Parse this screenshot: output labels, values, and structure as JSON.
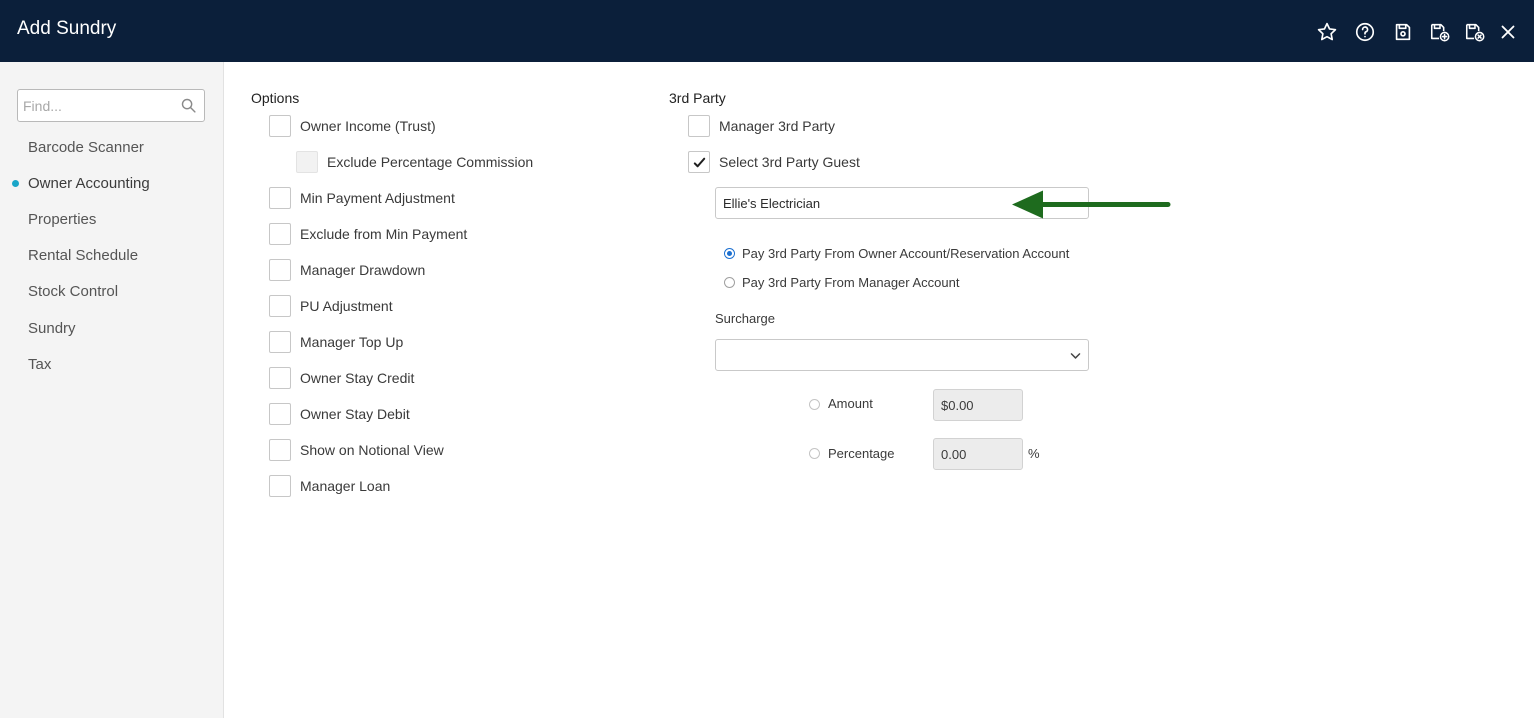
{
  "window": {
    "title": "Add Sundry",
    "toolbar_icons": [
      "star-icon",
      "help-icon",
      "save-icon",
      "save-and-new-icon",
      "save-and-close-icon",
      "close-icon"
    ]
  },
  "sidebar": {
    "search_placeholder": "Find...",
    "items": [
      {
        "label": "Barcode Scanner",
        "active": false
      },
      {
        "label": "Owner Accounting",
        "active": true
      },
      {
        "label": "Properties",
        "active": false
      },
      {
        "label": "Rental Schedule",
        "active": false
      },
      {
        "label": "Stock Control",
        "active": false
      },
      {
        "label": "Sundry",
        "active": false
      },
      {
        "label": "Tax",
        "active": false
      }
    ]
  },
  "options": {
    "heading": "Options",
    "items": [
      {
        "label": "Owner Income (Trust)",
        "checked": false
      },
      {
        "label": "Exclude Percentage Commission",
        "checked": false,
        "disabled": true
      },
      {
        "label": "Min Payment Adjustment",
        "checked": false
      },
      {
        "label": "Exclude from Min Payment",
        "checked": false
      },
      {
        "label": "Manager Drawdown",
        "checked": false
      },
      {
        "label": "PU Adjustment",
        "checked": false
      },
      {
        "label": "Manager Top Up",
        "checked": false
      },
      {
        "label": "Owner Stay Credit",
        "checked": false
      },
      {
        "label": "Owner Stay Debit",
        "checked": false
      },
      {
        "label": "Show on Notional View",
        "checked": false
      },
      {
        "label": "Manager Loan",
        "checked": false
      }
    ]
  },
  "third_party": {
    "heading": "3rd Party",
    "manager_3rd_party": {
      "label": "Manager 3rd Party",
      "checked": false
    },
    "select_3rd_party_guest": {
      "label": "Select 3rd Party Guest",
      "checked": true
    },
    "guest_value": "Ellie's Electrician",
    "pay_options": [
      {
        "label": "Pay 3rd Party From Owner Account/Reservation Account",
        "selected": true
      },
      {
        "label": "Pay 3rd Party From Manager Account",
        "selected": false
      }
    ],
    "surcharge": {
      "label": "Surcharge",
      "selected_value": "",
      "amount": {
        "label": "Amount",
        "value": "$0.00",
        "selected": false
      },
      "percentage": {
        "label": "Percentage",
        "value": "0.00",
        "unit": "%",
        "selected": false
      }
    }
  },
  "annotation": {
    "arrow_color": "#1e6b1e"
  }
}
